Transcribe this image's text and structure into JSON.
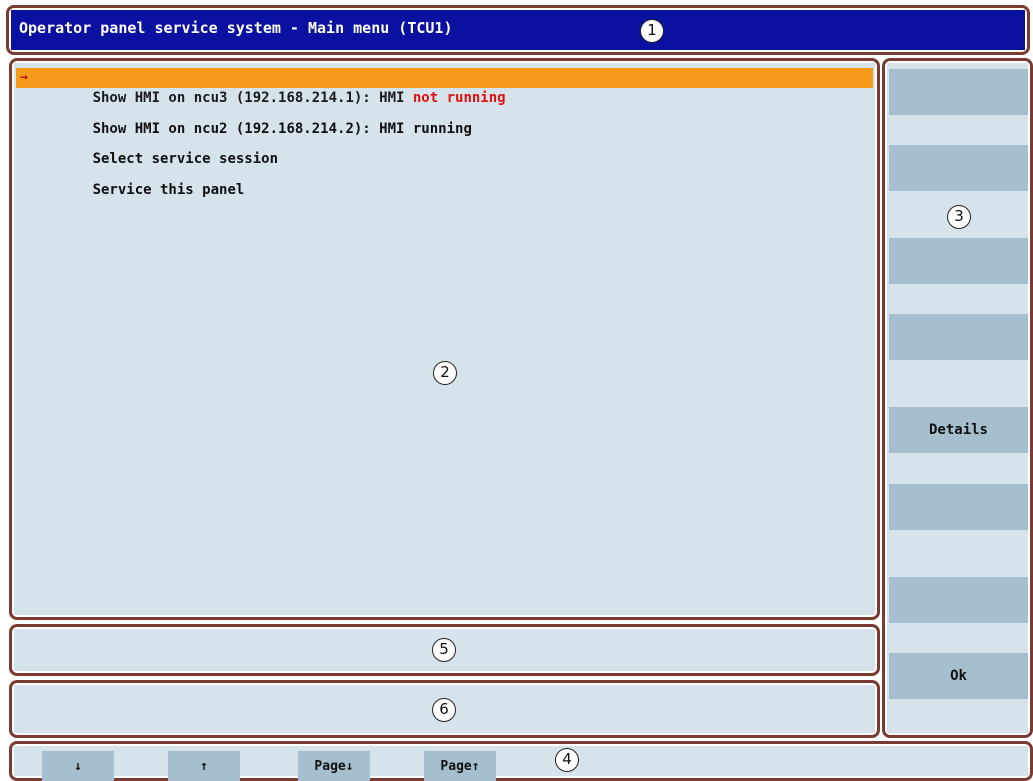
{
  "title_bar": {
    "text": "Operator panel service system - Main menu (TCU1)"
  },
  "menu": {
    "items": [
      {
        "prefix": "Show HMI on ncu3 (192.168.214.1): HMI ",
        "status": "not running",
        "selected": true
      },
      {
        "prefix": "Show HMI on ncu2 (192.168.214.2): HMI running",
        "status": "",
        "selected": false
      },
      {
        "prefix": "Select service session",
        "status": "",
        "selected": false
      },
      {
        "prefix": "Service this panel",
        "status": "",
        "selected": false
      }
    ],
    "selection_arrow": "→"
  },
  "vertical_softkeys": [
    {
      "label": ""
    },
    {
      "label": ""
    },
    {
      "label": ""
    },
    {
      "label": ""
    },
    {
      "label": "Details"
    },
    {
      "label": ""
    },
    {
      "label": ""
    },
    {
      "label": "Ok"
    }
  ],
  "horizontal_softkeys": [
    {
      "label": "↓"
    },
    {
      "label": "↑"
    },
    {
      "label": "Page↓"
    },
    {
      "label": "Page↑"
    }
  ],
  "callouts": [
    "1",
    "2",
    "3",
    "4",
    "5",
    "6"
  ],
  "colors": {
    "title_bg": "#0a10a0",
    "panel_bg": "#d6e3ea",
    "softkey_bg": "#a6bfcf",
    "selection_bg": "#f59a1a",
    "status_error": "#e01010",
    "frame_border": "#7a3b33"
  }
}
